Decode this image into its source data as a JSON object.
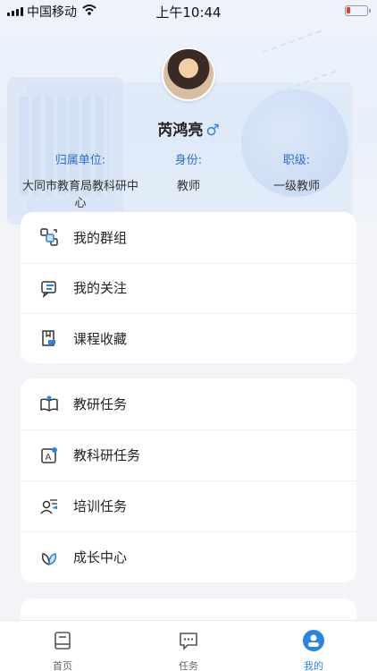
{
  "status_bar": {
    "carrier": "中国移动",
    "time": "上午10:44"
  },
  "profile": {
    "name": "芮鸿亮",
    "gender_symbol": "♂",
    "info": [
      {
        "label": "归属单位:",
        "value": "大同市教育局教科研中心"
      },
      {
        "label": "身份:",
        "value": "教师"
      },
      {
        "label": "职级:",
        "value": "一级教师"
      }
    ]
  },
  "menu_group1": [
    {
      "label": "我的群组",
      "icon": "group-icon"
    },
    {
      "label": "我的关注",
      "icon": "follow-icon"
    },
    {
      "label": "课程收藏",
      "icon": "course-favorite-icon"
    }
  ],
  "menu_group2": [
    {
      "label": "教研任务",
      "icon": "research-task-icon"
    },
    {
      "label": "教科研任务",
      "icon": "science-research-task-icon"
    },
    {
      "label": "培训任务",
      "icon": "training-task-icon"
    },
    {
      "label": "成长中心",
      "icon": "growth-center-icon"
    }
  ],
  "tab_bar": {
    "items": [
      {
        "label": "首页",
        "icon": "home-icon"
      },
      {
        "label": "任务",
        "icon": "task-icon"
      },
      {
        "label": "我的",
        "icon": "profile-icon",
        "active": true
      }
    ]
  },
  "colors": {
    "accent": "#2b83e5",
    "label_blue": "#2b6fd1"
  }
}
